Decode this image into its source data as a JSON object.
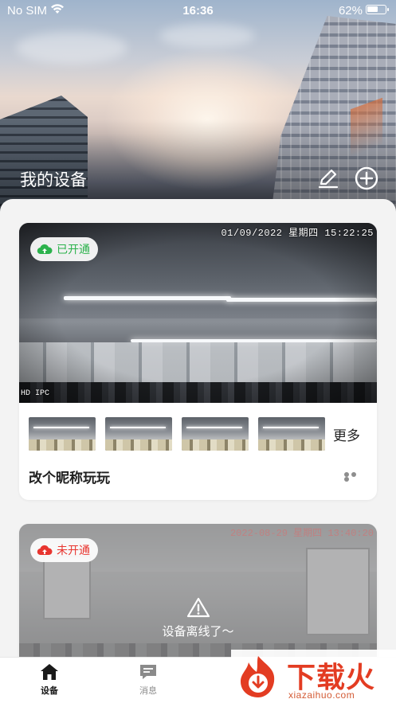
{
  "status_bar": {
    "carrier": "No SIM",
    "time": "16:36",
    "battery_percent": "62%",
    "battery_level": 0.62
  },
  "header": {
    "title": "我的设备",
    "edit_icon": "pencil-icon",
    "add_icon": "plus-circle-icon"
  },
  "devices": [
    {
      "badge": "已开通",
      "badge_color": "#2bb24c",
      "overlay_timestamp": "01/09/2022 星期四 15:22:25",
      "overlay_tag": "HD IPC",
      "thumbnails": [
        "thumb-1",
        "thumb-2",
        "thumb-3",
        "thumb-4"
      ],
      "more_label": "更多",
      "name": "改个昵称玩玩",
      "menu_icon": "more-dots-icon"
    },
    {
      "badge": "未开通",
      "badge_color": "#e8352f",
      "overlay_timestamp": "2022-08-29 星期四 13:40:20",
      "offline_message": "设备离线了～"
    }
  ],
  "tabbar": {
    "tabs": [
      {
        "label": "设备",
        "icon": "home-icon",
        "active": true
      },
      {
        "label": "消息",
        "icon": "message-icon",
        "active": false
      }
    ]
  },
  "watermark": {
    "title": "下载火",
    "url": "xiazaihuo.com",
    "color": "#e33c22"
  }
}
